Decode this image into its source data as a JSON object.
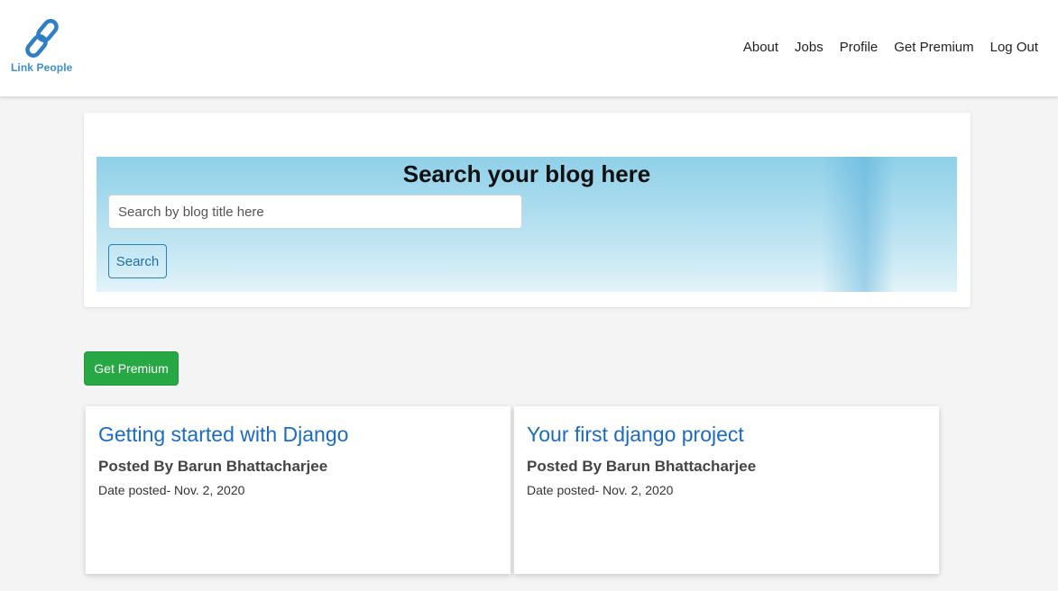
{
  "brand": {
    "name": "Link People",
    "icon": "chain-link-icon"
  },
  "nav": {
    "items": [
      {
        "label": "About"
      },
      {
        "label": "Jobs"
      },
      {
        "label": "Profile"
      },
      {
        "label": "Get Premium"
      },
      {
        "label": "Log Out"
      }
    ]
  },
  "search": {
    "title": "Search your blog here",
    "placeholder": "Search by blog title here",
    "value": "",
    "button_label": "Search"
  },
  "premium_button": {
    "label": "Get Premium"
  },
  "posts": [
    {
      "title": "Getting started with Django",
      "author_prefix": "Posted By",
      "author": "Barun Bhattacharjee",
      "date": "Date posted- Nov. 2, 2020"
    },
    {
      "title": "Your first django project",
      "author_prefix": "Posted By",
      "author": "Barun Bhattacharjee",
      "date": "Date posted- Nov. 2, 2020"
    }
  ],
  "colors": {
    "accent": "#1a6bc4",
    "brand": "#3b8fd6",
    "success": "#28a745"
  }
}
